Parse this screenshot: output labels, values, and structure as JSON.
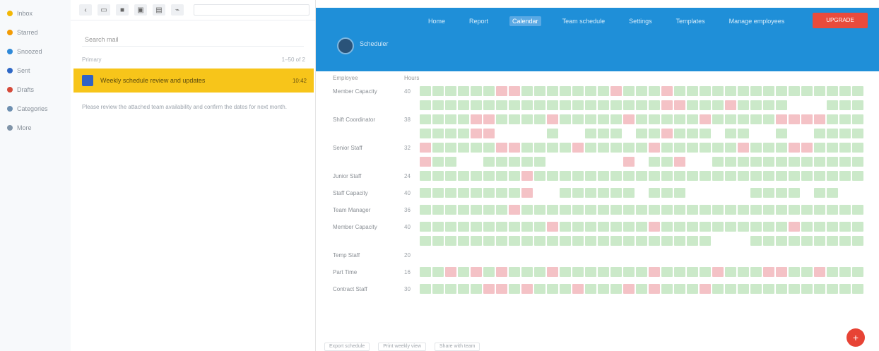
{
  "left_nav": [
    {
      "label": "Inbox",
      "color": "#f2b705"
    },
    {
      "label": "Starred",
      "color": "#f29b05"
    },
    {
      "label": "Snoozed",
      "color": "#2f89d8"
    },
    {
      "label": "Sent",
      "color": "#2f68c6"
    },
    {
      "label": "Drafts",
      "color": "#d54a3a"
    },
    {
      "label": "Categories",
      "color": "#6d8fb0"
    },
    {
      "label": "More",
      "color": "#8094a8"
    }
  ],
  "mail": {
    "filter_placeholder": "Search mail",
    "list_left": "Primary",
    "list_right": "1–50 of 2",
    "row_subject": "Weekly schedule review and updates",
    "row_right": "10:42",
    "preview": "Please review the attached team availability and confirm the dates for next month."
  },
  "app": {
    "menu": [
      "Home",
      "Report",
      "Calendar",
      "Team schedule",
      "Settings",
      "Templates",
      "Manage employees"
    ],
    "active_menu_index": 2,
    "cta": "UPGRADE",
    "name": "Scheduler",
    "grid_header": {
      "name": "Employee",
      "num": "Hours"
    },
    "rows": [
      {
        "name": "Member Capacity",
        "num": "40"
      },
      {
        "name": "",
        "num": ""
      },
      {
        "name": "Shift Coordinator",
        "num": "38"
      },
      {
        "name": "",
        "num": ""
      },
      {
        "name": "Senior Staff",
        "num": "32"
      },
      {
        "name": "",
        "num": ""
      },
      {
        "name": "Junior Staff",
        "num": "24"
      },
      {
        "name": "Staff Capacity",
        "num": "40"
      },
      {
        "name": "Team Manager",
        "num": "36"
      },
      {
        "name": "Member Capacity",
        "num": "40"
      },
      {
        "name": "",
        "num": ""
      },
      {
        "name": "Temp Staff",
        "num": "20"
      },
      {
        "name": "Part Time",
        "num": "16"
      },
      {
        "name": "Contract Staff",
        "num": "30"
      }
    ],
    "footer_buttons": [
      "Export schedule",
      "Print weekly view",
      "Share with team"
    ]
  },
  "colors": {
    "green": "#cbe9c9",
    "red": "#f4c2c6",
    "blue": "#1f8fd8",
    "yellow": "#f7c51a"
  }
}
